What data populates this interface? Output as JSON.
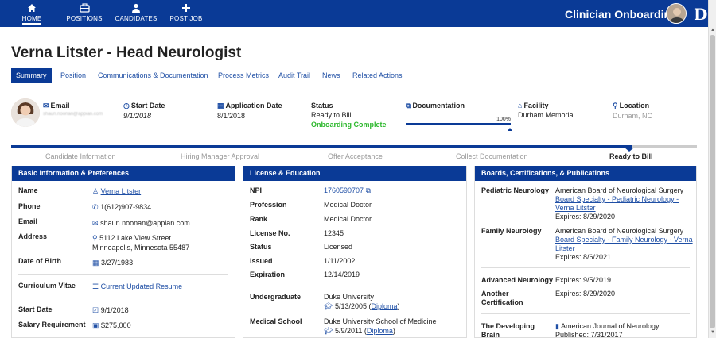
{
  "nav": {
    "home": "HOME",
    "positions": "POSITIONS",
    "candidates": "CANDIDATES",
    "post_job": "POST JOB",
    "app_title": "Clinician Onboarding",
    "logo": "D"
  },
  "page": {
    "title": "Verna Litster - Head Neurologist"
  },
  "tabs": [
    "Summary",
    "Position",
    "Communications & Documentation",
    "Process Metrics",
    "Audit Trail",
    "News",
    "Related Actions"
  ],
  "header": {
    "email_label": "Email",
    "email_value": "shaun.noonan@appian.com",
    "start_label": "Start Date",
    "start_value": "9/1/2018",
    "appdate_label": "Application Date",
    "appdate_value": "8/1/2018",
    "status_label": "Status",
    "status_value": "Ready to Bill",
    "status_sub": "Onboarding Complete",
    "doc_label": "Documentation",
    "doc_progress": 100,
    "doc_progress_text": "100%",
    "facility_label": "Facility",
    "facility_value": "Durham Memorial",
    "location_label": "Location",
    "location_value": "Durham, NC"
  },
  "steps": [
    "Candidate Information",
    "Hiring Manager Approval",
    "Offer Acceptance",
    "Collect Documentation",
    "Ready to Bill"
  ],
  "basic": {
    "title": "Basic Information & Preferences",
    "name_label": "Name",
    "name_value": "Verna Litster",
    "phone_label": "Phone",
    "phone_value": "1(612)907-9834",
    "email_label": "Email",
    "email_value": "shaun.noonan@appian.com",
    "address_label": "Address",
    "address_line1": "5112 Lake View Street",
    "address_line2": "Minneapolis, Minnesota 55487",
    "dob_label": "Date of Birth",
    "dob_value": "3/27/1983",
    "cv_label": "Curriculum Vitae",
    "cv_value": "Current Updated Resume",
    "start_label": "Start Date",
    "start_value": "9/1/2018",
    "salary_label": "Salary Requirement",
    "salary_value": "$275,000"
  },
  "license": {
    "title": "License & Education",
    "npi_label": "NPI",
    "npi_value": "1760590707",
    "profession_label": "Profession",
    "profession_value": "Medical Doctor",
    "rank_label": "Rank",
    "rank_value": "Medical Doctor",
    "license_label": "License No.",
    "license_value": "12345",
    "status_label": "Status",
    "status_value": "Licensed",
    "issued_label": "Issued",
    "issued_value": "1/11/2002",
    "expiration_label": "Expiration",
    "expiration_value": "12/14/2019",
    "ug_label": "Undergraduate",
    "ug_school": "Duke University",
    "ug_date": "5/13/2005",
    "ug_diploma": "Diploma",
    "med_label": "Medical School",
    "med_school": "Duke University School of Medicine",
    "med_date": "5/9/2011",
    "med_diploma": "Diploma"
  },
  "boards": {
    "title": "Boards, Certifications, & Publications",
    "ped_label": "Pediatric Neurology",
    "ped_org": "American Board of Neurological Surgery",
    "ped_link1": "Board Specialty - Pediatric Neurology -",
    "ped_link2": "Verna Litster",
    "ped_expires": "Expires: 8/29/2020",
    "fam_label": "Family Neurology",
    "fam_org": "American Board of Neurological Surgery",
    "fam_link1": "Board Specialty - Family Neurology - Verna",
    "fam_link2": "Litster",
    "fam_expires": "Expires: 8/6/2021",
    "adv_label": "Advanced Neurology",
    "adv_expires": "Expires: 9/5/2019",
    "other_label1": "Another",
    "other_label2": "Certification",
    "other_expires": "Expires: 8/29/2020",
    "pub_label1": "The Developing",
    "pub_label2": "Brain",
    "pub_journal": "American Journal of Neurology",
    "pub_date": "Published: 7/31/2017"
  }
}
